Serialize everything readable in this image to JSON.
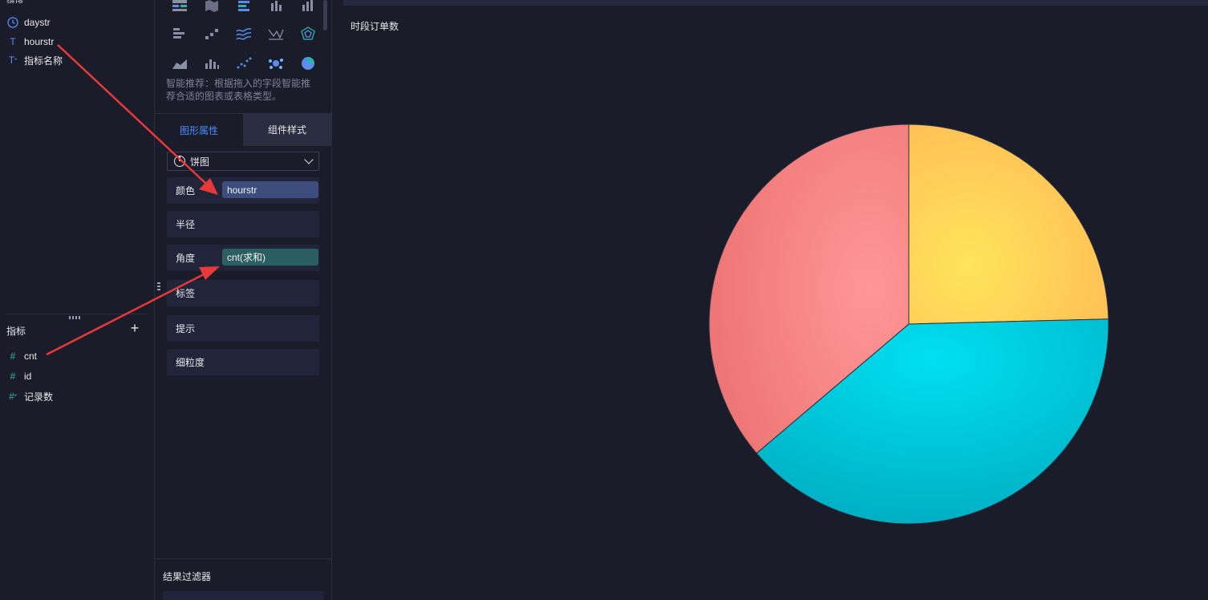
{
  "dimensions": {
    "fields": [
      {
        "icon": "clock-icon",
        "label": "daystr"
      },
      {
        "icon": "text-type-icon",
        "label": "hourstr"
      },
      {
        "icon": "text-calc-icon",
        "label": "指标名称"
      }
    ]
  },
  "measures": {
    "title": "指标",
    "add_label": "+",
    "fields": [
      {
        "icon": "hash-icon",
        "label": "cnt"
      },
      {
        "icon": "hash-icon",
        "label": "id"
      },
      {
        "icon": "hash-calc-icon",
        "label": "记录数"
      }
    ]
  },
  "config": {
    "recommend_text": "智能推荐：根据拖入的字段智能推荐合适的图表或表格类型。",
    "tabs": [
      "图形属性",
      "组件样式"
    ],
    "chart_type": "饼图",
    "props": [
      {
        "label": "颜色",
        "pill": "hourstr",
        "pill_kind": "dim"
      },
      {
        "label": "半径",
        "pill": "",
        "pill_kind": ""
      },
      {
        "label": "角度",
        "pill": "cnt(求和)",
        "pill_kind": "measure"
      },
      {
        "label": "标签",
        "pill": "",
        "pill_kind": ""
      },
      {
        "label": "提示",
        "pill": "",
        "pill_kind": ""
      },
      {
        "label": "细粒度",
        "pill": "",
        "pill_kind": ""
      }
    ],
    "filter_title": "结果过滤器"
  },
  "canvas": {
    "chart_title": "时段订单数"
  },
  "colors": {
    "accent": "#4a8cff",
    "slice_yellow": "#ffc857",
    "slice_cyan": "#00c4d9",
    "slice_red": "#f47c7c",
    "arrow": "#e8393a"
  },
  "chart_data": {
    "type": "pie",
    "title": "时段订单数",
    "slices": [
      {
        "value": 24.6,
        "color": "#ffc857"
      },
      {
        "value": 39.2,
        "color": "#00c4d9"
      },
      {
        "value": 36.2,
        "color": "#f47c7c"
      }
    ]
  }
}
